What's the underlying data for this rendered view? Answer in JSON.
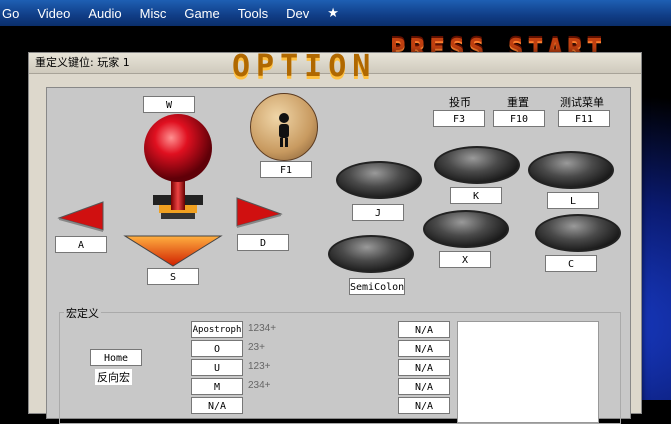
{
  "menubar": {
    "items": [
      "Go",
      "Video",
      "Audio",
      "Misc",
      "Game",
      "Tools",
      "Dev",
      "★"
    ]
  },
  "background": {
    "press_start": "PRESS START",
    "option": "OPTION"
  },
  "dialog": {
    "title": "重定义键位: 玩家 1"
  },
  "joystick": {
    "up": "W",
    "left": "A",
    "right": "D",
    "down": "S"
  },
  "coin_button": {
    "key": "F1"
  },
  "top_actions": [
    {
      "label": "投币",
      "key": "F3"
    },
    {
      "label": "重置",
      "key": "F10"
    },
    {
      "label": "测试菜单",
      "key": "F11"
    }
  ],
  "buttons": [
    {
      "key": "J"
    },
    {
      "key": "K"
    },
    {
      "key": "L"
    },
    {
      "key": "SemiColon"
    },
    {
      "key": "X"
    },
    {
      "key": "C"
    }
  ],
  "macro": {
    "legend": "宏定义",
    "home_key": "Home",
    "reverse_label": "反向宏",
    "rows": [
      {
        "key": "Apostroph",
        "seq": "1234+",
        "assign": "N/A"
      },
      {
        "key": "O",
        "seq": "23+",
        "assign": "N/A"
      },
      {
        "key": "U",
        "seq": "123+",
        "assign": "N/A"
      },
      {
        "key": "M",
        "seq": "234+",
        "assign": "N/A"
      },
      {
        "key": "N/A",
        "seq": "",
        "assign": "N/A"
      }
    ]
  },
  "colors": {
    "menubar": "#103d86",
    "dialog_bg": "#ddd8cc",
    "panel_bg": "#c8c8c8",
    "joystick_ball": "#e01020",
    "arrow_red": "#d01010"
  }
}
